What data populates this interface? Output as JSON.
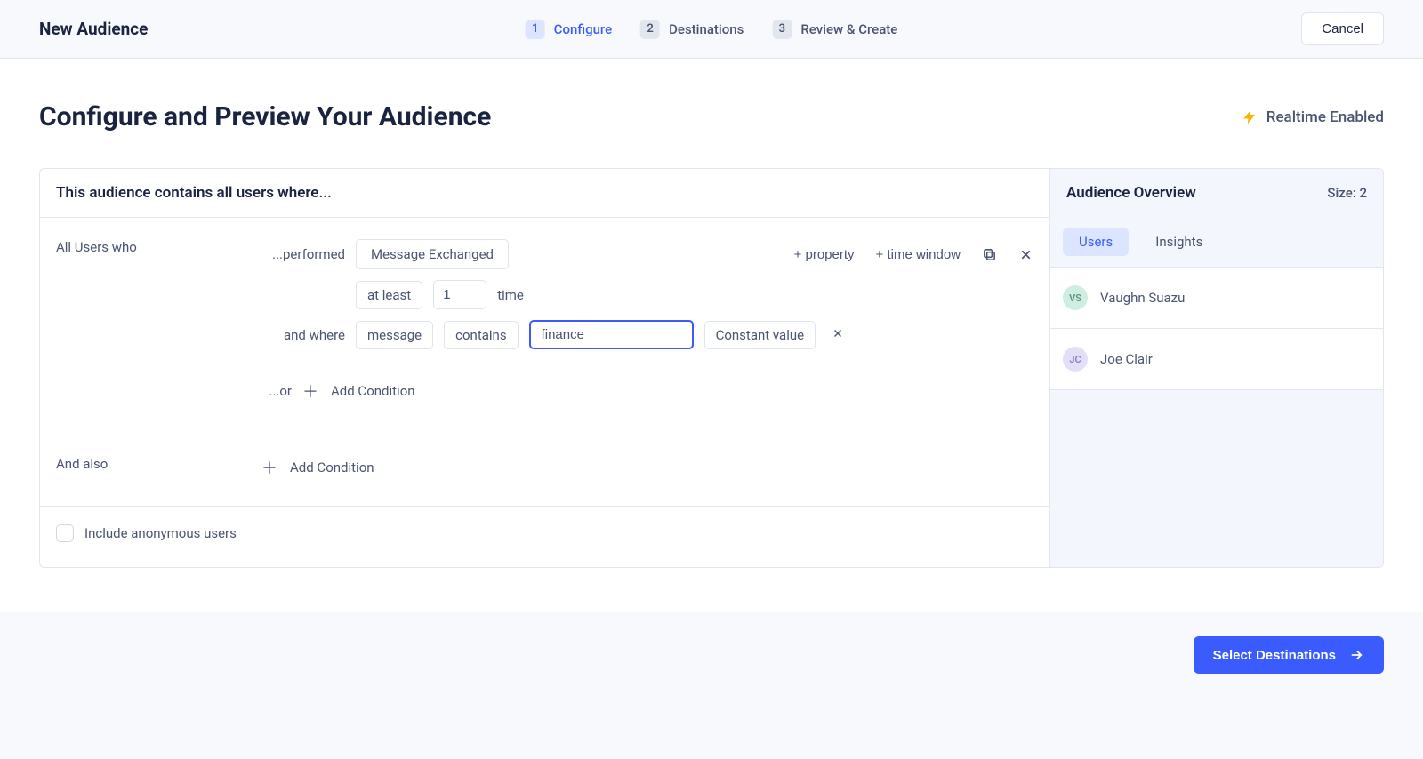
{
  "header": {
    "title": "New Audience",
    "steps": [
      {
        "num": "1",
        "label": "Configure",
        "active": true
      },
      {
        "num": "2",
        "label": "Destinations",
        "active": false
      },
      {
        "num": "3",
        "label": "Review & Create",
        "active": false
      }
    ],
    "cancel": "Cancel"
  },
  "main": {
    "heading": "Configure and Preview Your Audience",
    "realtime_label": "Realtime Enabled",
    "panel_header": "This audience contains all users where...",
    "condition": {
      "left_label_1": "All Users who",
      "performed_label": "...performed",
      "event_name": "Message Exchanged",
      "add_property": "+ property",
      "add_time_window": "+ time window",
      "freq_operator": "at least",
      "freq_value": "1",
      "freq_unit": "time",
      "and_where_label": "and where",
      "prop_name": "message",
      "prop_operator": "contains",
      "prop_value": "finance",
      "value_type": "Constant value",
      "or_label": "...or",
      "add_condition": "Add Condition",
      "left_label_2": "And also",
      "include_anon": "Include anonymous users"
    }
  },
  "overview": {
    "title": "Audience Overview",
    "size_label": "Size: ",
    "size_value": "2",
    "tabs": [
      {
        "label": "Users",
        "active": true
      },
      {
        "label": "Insights",
        "active": false
      }
    ],
    "users": [
      {
        "initials": "VS",
        "name": "Vaughn Suazu",
        "bg": "#cdeee0",
        "fg": "#5e9483"
      },
      {
        "initials": "JC",
        "name": "Joe Clair",
        "bg": "#e3dff7",
        "fg": "#8b7fc2"
      }
    ]
  },
  "footer": {
    "primary": "Select Destinations"
  }
}
